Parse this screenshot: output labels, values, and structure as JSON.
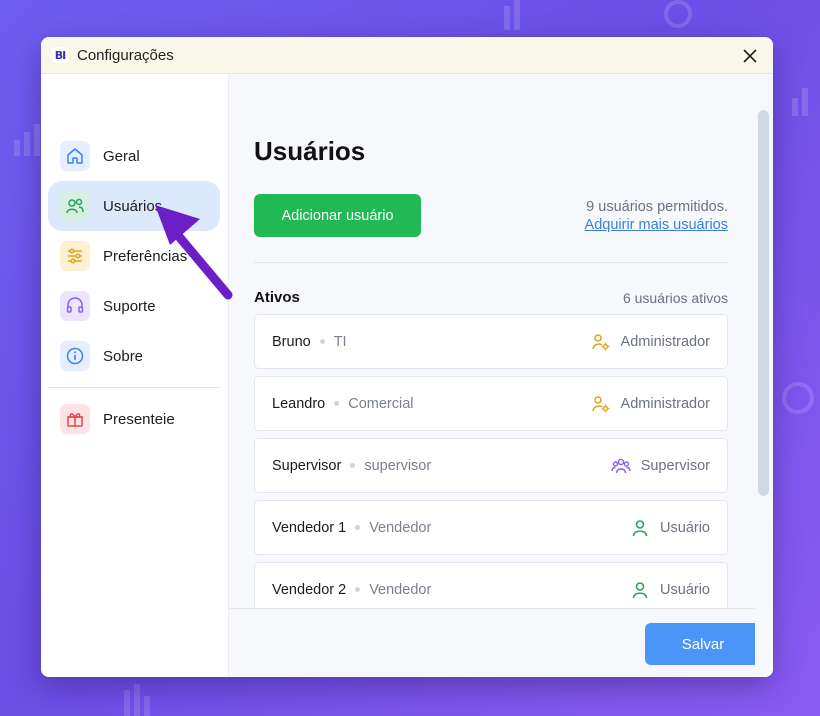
{
  "window": {
    "logo_text": "BI",
    "title": "Configurações"
  },
  "sidebar": {
    "items": [
      {
        "label": "Geral",
        "icon": "home-icon",
        "color": "#3b82f6",
        "bg": "#e4eefc"
      },
      {
        "label": "Usuários",
        "icon": "users-icon",
        "color": "#22a35a",
        "bg": "#d6efe2",
        "active": true
      },
      {
        "label": "Preferências",
        "icon": "sliders-icon",
        "color": "#e0a21a",
        "bg": "#fdf0d2"
      },
      {
        "label": "Suporte",
        "icon": "headset-icon",
        "color": "#8b5cf6",
        "bg": "#ece5fd"
      },
      {
        "label": "Sobre",
        "icon": "info-icon",
        "color": "#3b82f6",
        "bg": "#e4eefc"
      },
      {
        "label": "Presenteie",
        "icon": "gift-icon",
        "color": "#e24a4a",
        "bg": "#fde3e3"
      }
    ]
  },
  "main": {
    "title": "Usuários",
    "add_button": "Adicionar usuário",
    "allowed_text": "9 usuários permitidos.",
    "more_link": "Adquirir mais usuários",
    "section_title": "Ativos",
    "section_count": "6 usuários ativos",
    "users": [
      {
        "name": "Bruno",
        "dept": "TI",
        "role": "Administrador",
        "role_icon": "user-gear-icon",
        "role_color": "#e0a21a"
      },
      {
        "name": "Leandro",
        "dept": "Comercial",
        "role": "Administrador",
        "role_icon": "user-gear-icon",
        "role_color": "#e0a21a"
      },
      {
        "name": "Supervisor",
        "dept": "supervisor",
        "role": "Supervisor",
        "role_icon": "users-group-icon",
        "role_color": "#8b5cf6"
      },
      {
        "name": "Vendedor 1",
        "dept": "Vendedor",
        "role": "Usuário",
        "role_icon": "user-icon",
        "role_color": "#22a35a"
      },
      {
        "name": "Vendedor 2",
        "dept": "Vendedor",
        "role": "Usuário",
        "role_icon": "user-icon",
        "role_color": "#22a35a"
      },
      {
        "name": "",
        "dept": "",
        "role": "",
        "role_icon": "user-icon",
        "role_color": "#22a35a"
      }
    ],
    "save_button": "Salvar"
  },
  "annotation": {
    "icon": "pointer-arrow-icon",
    "color": "#6a1fc7"
  }
}
